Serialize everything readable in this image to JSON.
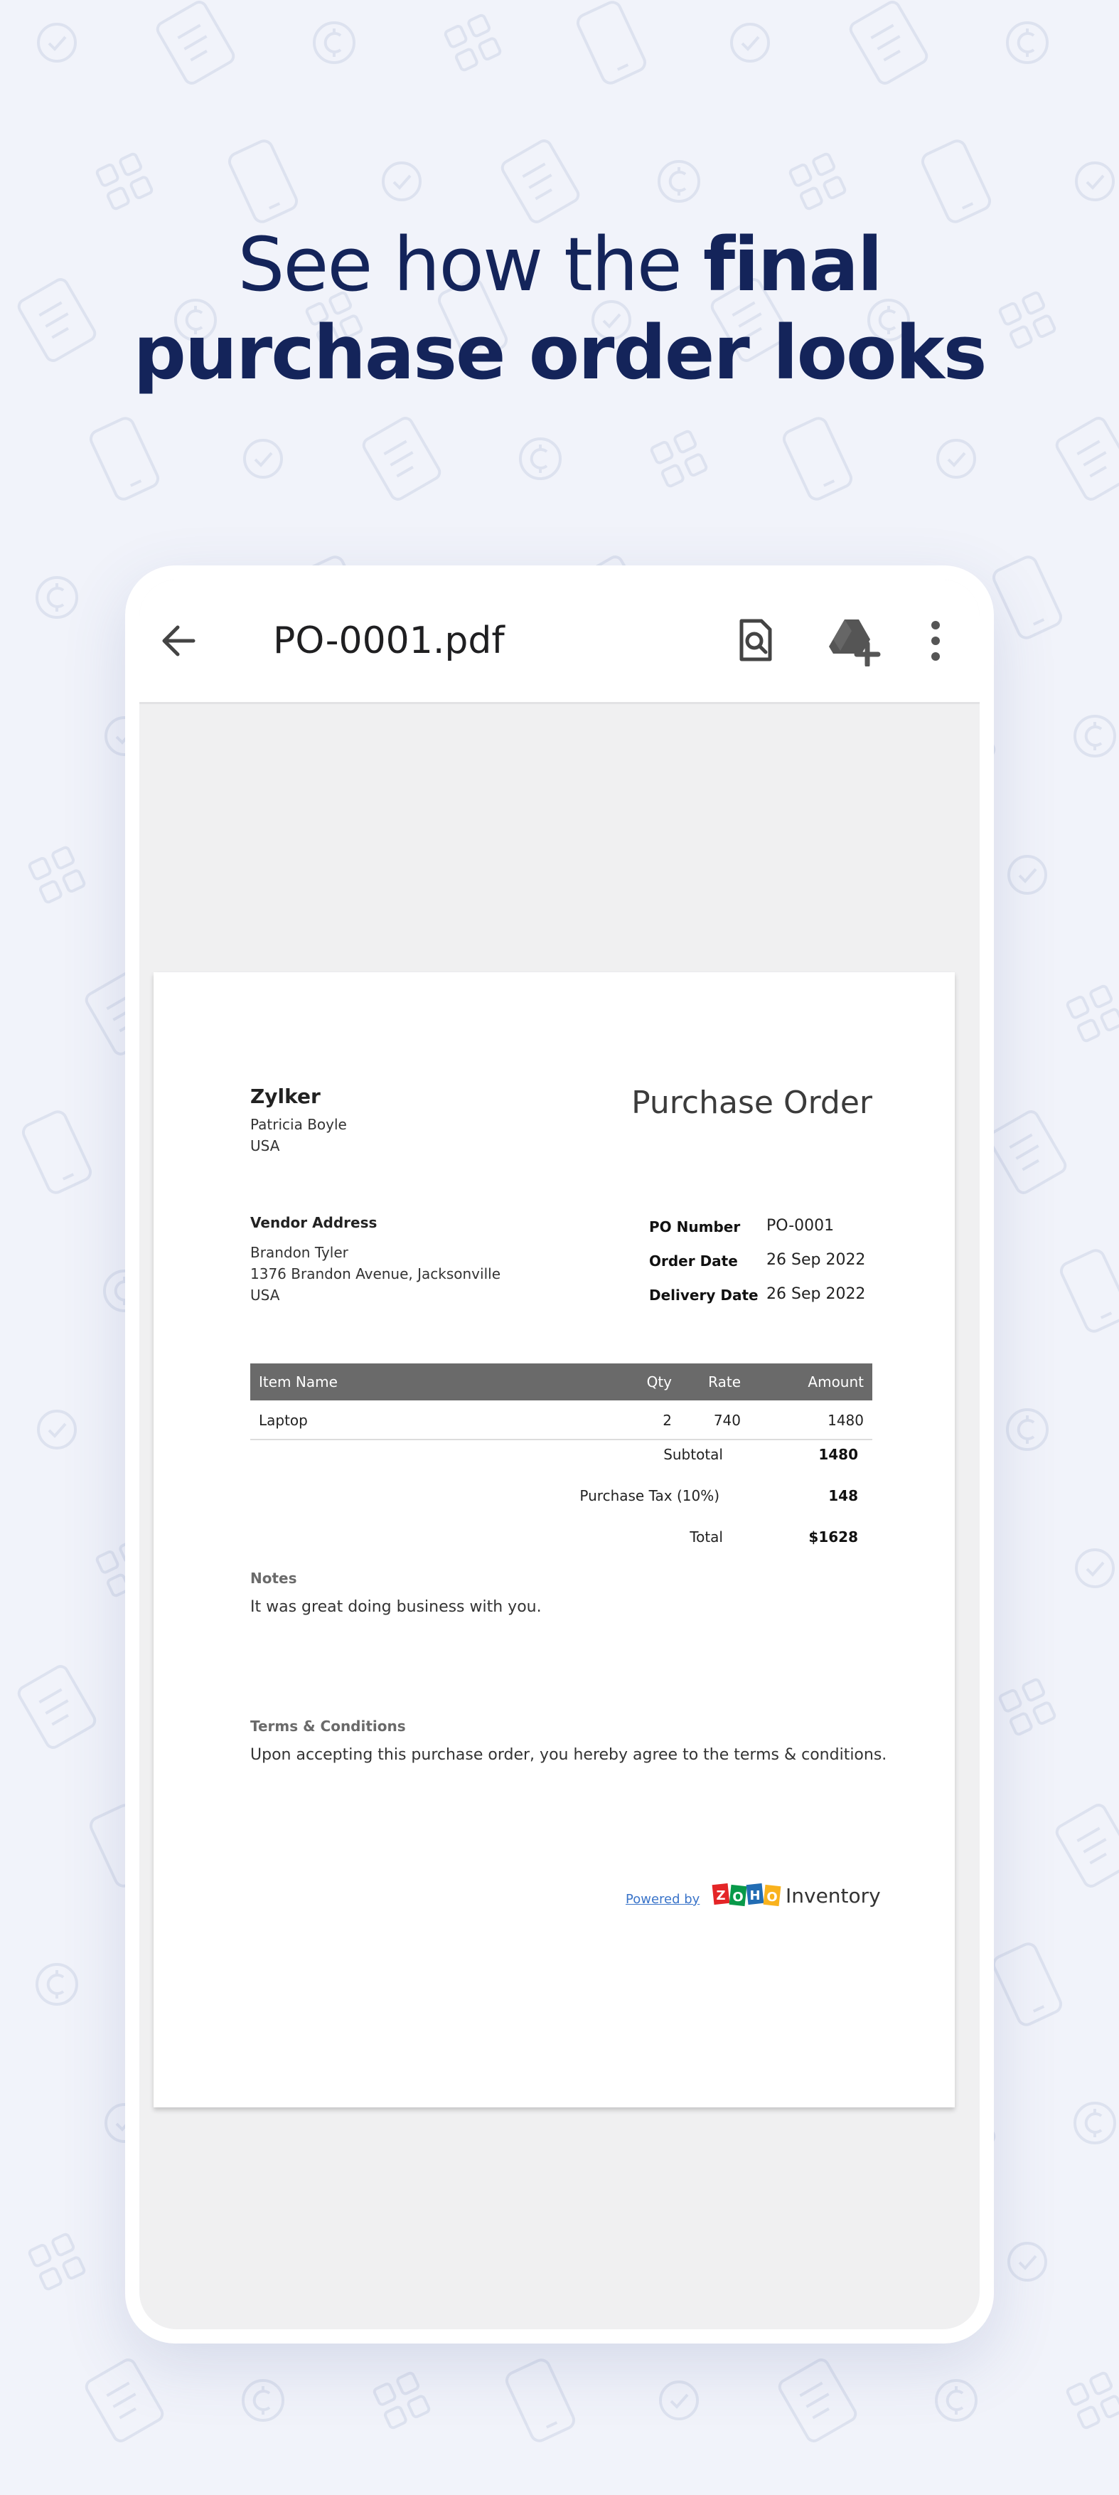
{
  "headline": {
    "line1_light": "See how the ",
    "line1_bold": "final",
    "line2_bold": "purchase order looks"
  },
  "app_bar": {
    "back_icon": "arrow-left-icon",
    "file_name": "PO-0001.pdf",
    "search_icon": "document-search-icon",
    "drive_icon": "drive-add-icon",
    "more_icon": "more-vertical-icon"
  },
  "document": {
    "company": {
      "name": "Zylker",
      "contact": "Patricia Boyle",
      "country": "USA"
    },
    "title": "Purchase Order",
    "vendor": {
      "label": "Vendor Address",
      "name": "Brandon Tyler",
      "street": "1376 Brandon Avenue, Jacksonville",
      "country": "USA"
    },
    "meta": [
      {
        "label": "PO Number",
        "value": "PO-0001"
      },
      {
        "label": "Order Date",
        "value": "26 Sep 2022"
      },
      {
        "label": "Delivery Date",
        "value": "26 Sep 2022"
      }
    ],
    "table": {
      "headers": {
        "name": "Item Name",
        "qty": "Qty",
        "rate": "Rate",
        "amount": "Amount"
      },
      "rows": [
        {
          "name": "Laptop",
          "qty": "2",
          "rate": "740",
          "amount": "1480"
        }
      ]
    },
    "totals": [
      {
        "label": "Subtotal",
        "value": "1480"
      },
      {
        "label": "Purchase Tax (10%)",
        "value": "148"
      },
      {
        "label": "Total",
        "value": "$1628"
      }
    ],
    "notes": {
      "label": "Notes",
      "text": "It was great doing business with you."
    },
    "terms": {
      "label": "Terms & Conditions",
      "text": "Upon accepting this purchase order, you hereby agree to the terms & conditions."
    },
    "footer": {
      "powered_by": "Powered by",
      "logo_text": "ZOHO",
      "product": "Inventory"
    }
  },
  "colors": {
    "background": "#f1f3fa",
    "headline": "#14245a",
    "table_header": "#6a6a6a",
    "link": "#3a74c9"
  }
}
